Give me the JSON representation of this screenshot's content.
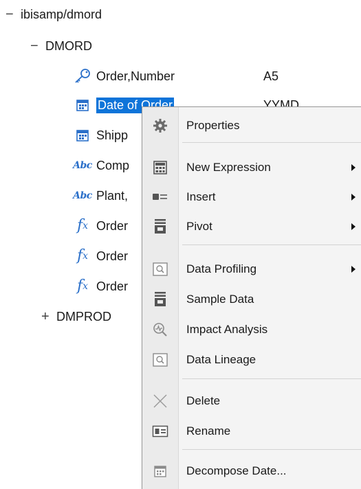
{
  "tree": {
    "root": {
      "toggle": "−",
      "label": "ibisamp/dmord"
    },
    "segment": {
      "toggle": "−",
      "label": "DMORD"
    },
    "fields": [
      {
        "icon": "key-icon",
        "label": "Order,Number",
        "format": "A5"
      },
      {
        "icon": "calendar-icon",
        "label": "Date of Order",
        "format": "YYMD"
      },
      {
        "icon": "calendar-icon",
        "label": "Shipp"
      },
      {
        "icon": "abc-icon",
        "label": "Comp"
      },
      {
        "icon": "abc-icon",
        "label": "Plant,"
      },
      {
        "icon": "fx-icon",
        "label": "Order"
      },
      {
        "icon": "fx-icon",
        "label": "Order"
      },
      {
        "icon": "fx-icon",
        "label": "Order"
      }
    ],
    "collapsed": {
      "toggle": "+",
      "label": "DMPROD"
    }
  },
  "menu": {
    "items": [
      {
        "label": "Properties",
        "icon": "gear-icon",
        "submenu": false
      },
      {
        "label": "New Expression",
        "icon": "calculator-icon",
        "submenu": true
      },
      {
        "label": "Insert",
        "icon": "insert-icon",
        "submenu": true
      },
      {
        "label": "Pivot",
        "icon": "pivot-icon",
        "submenu": true
      },
      {
        "label": "Data Profiling",
        "icon": "profile-icon",
        "submenu": true
      },
      {
        "label": "Sample Data",
        "icon": "sample-data-icon",
        "submenu": false
      },
      {
        "label": "Impact Analysis",
        "icon": "impact-icon",
        "submenu": false
      },
      {
        "label": "Data Lineage",
        "icon": "lineage-icon",
        "submenu": false
      },
      {
        "label": "Delete",
        "icon": "delete-icon",
        "submenu": false
      },
      {
        "label": "Rename",
        "icon": "rename-icon",
        "submenu": false
      },
      {
        "label": "Decompose Date...",
        "icon": "decompose-date-icon",
        "submenu": false
      }
    ]
  },
  "colors": {
    "selection": "#0e74d9",
    "icon_blue": "#2a6fc9",
    "menu_bg": "#f4f4f4"
  }
}
